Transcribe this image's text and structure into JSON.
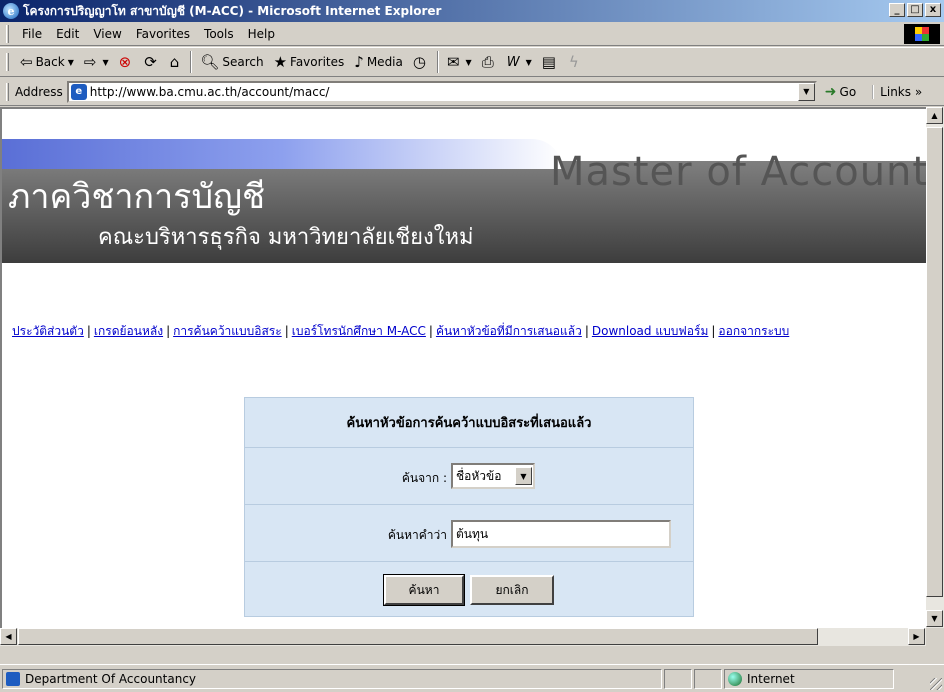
{
  "window": {
    "title": "โครงการปริญญาโท สาขาบัญชี (M-ACC) - Microsoft Internet Explorer",
    "controls": [
      "_",
      "□",
      "x"
    ]
  },
  "menubar": {
    "items": [
      "File",
      "Edit",
      "View",
      "Favorites",
      "Tools",
      "Help"
    ]
  },
  "toolbar": {
    "back": "Back",
    "search": "Search",
    "favorites": "Favorites",
    "media": "Media"
  },
  "addressbar": {
    "label": "Address",
    "url": "http://www.ba.cmu.ac.th/account/macc/",
    "go": "Go",
    "links": "Links »"
  },
  "banner": {
    "title_en": "Master of Accounti",
    "dept_th": "ภาควิชาการบัญชี",
    "faculty_th": "คณะบริหารธุรกิจ มหาวิทยาลัยเชียงใหม่"
  },
  "nav": {
    "links": [
      "ประวัติส่วนตัว",
      "เกรดย้อนหลัง",
      "การค้นคว้าแบบอิสระ",
      "เบอร์โทรนักศึกษา M-ACC",
      "ค้นหาหัวข้อที่มีการเสนอแล้ว",
      "Download แบบฟอร์ม",
      "ออกจากระบบ"
    ],
    "separator": "|"
  },
  "search_form": {
    "heading": "ค้นหาหัวข้อการค้นคว้าแบบอิสระที่เสนอแล้ว",
    "from_label": "ค้นจาก :",
    "from_value": "ชื่อหัวข้อ",
    "keyword_label": "ค้นหาคำว่า",
    "keyword_value": "ต้นทุน",
    "search_button": "ค้นหา",
    "cancel_button": "ยกเลิก"
  },
  "statusbar": {
    "text": "Department Of Accountancy",
    "zone": "Internet"
  }
}
